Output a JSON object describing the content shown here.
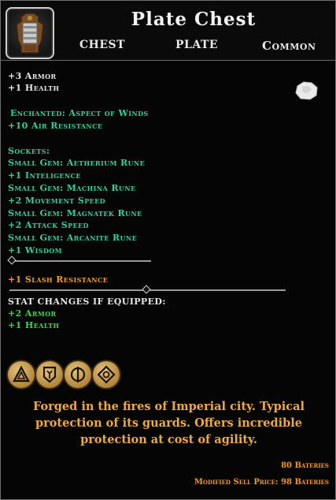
{
  "item": {
    "name": "Plate Chest",
    "slot": "CHEST",
    "type": "PLATE",
    "rarity": "Common",
    "icon": "plate-chest-armor-icon"
  },
  "base_stats": [
    "+3 Armor",
    "+1 Health"
  ],
  "enchant": {
    "title": "Enchanted: Aspect of Winds",
    "effect": "+10 Air Resistance"
  },
  "sockets": {
    "header": "Sockets:",
    "lines": [
      "Small Gem: Aetherium Rune",
      "+1 Inteligence",
      "Small Gem: Machina Rune",
      "+2 Movement Speed",
      "Small Gem: Magnatek Rune",
      "+2 Attack Speed",
      "Small Gem: Arcanite Rune",
      "+1 Wisdom"
    ]
  },
  "bonus": "+1 Slash Resistance",
  "compare": {
    "header": "STAT CHANGES IF EQUIPPED:",
    "lines": [
      "+2 Armor",
      "+1 Health"
    ]
  },
  "description": "Forged in the fires of Imperial city. Typical protection of its guards. Offers incredible protection at cost of agility.",
  "price": {
    "base": "80 Bateries",
    "modified_label": "Modified Sell Price:",
    "modified_value": "98 Bateries"
  },
  "colors": {
    "enchant": "#2fd0a0",
    "bonus": "#ff9a1a",
    "compare": "#3ed34a",
    "description": "#f0a93a"
  }
}
